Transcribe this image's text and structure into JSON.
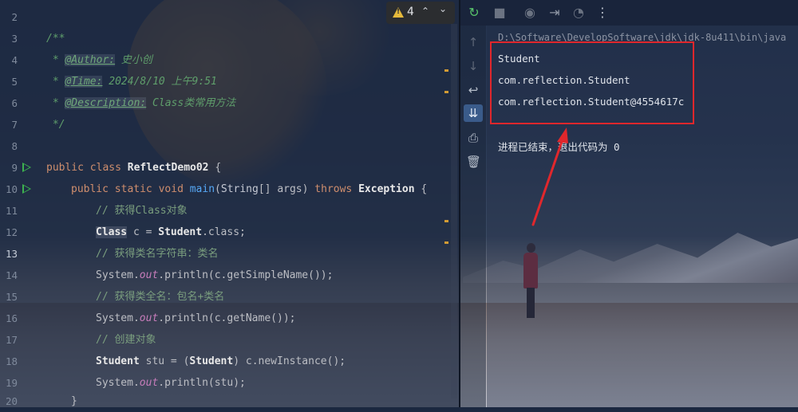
{
  "editor": {
    "warnings": {
      "count": "4",
      "icon": "warning-icon"
    },
    "lines": {
      "l2": "2",
      "l3": "3",
      "l4": "4",
      "l5": "5",
      "l6": "6",
      "l7": "7",
      "l8": "8",
      "l9": "9",
      "l10": "10",
      "l11": "11",
      "l12": "12",
      "l13": "13",
      "l14": "14",
      "l15": "15",
      "l16": "16",
      "l17": "17",
      "l18": "18",
      "l19": "19",
      "l20": "20"
    },
    "code": {
      "doc_open": "/**",
      "doc_star": " * ",
      "author_tag": "@Author:",
      "author_val": " 史小创",
      "time_tag": "@Time:",
      "time_val": " 2024/8/10 上午9:51",
      "desc_tag": "@Description:",
      "desc_val": " Class类常用方法",
      "doc_close": " */",
      "kw_public": "public",
      "kw_class": "class",
      "class_name": "ReflectDemo02",
      "brace_open": " {",
      "kw_static": "static",
      "kw_void": "void",
      "method_main": "main",
      "main_params_open": "(",
      "type_string": "String",
      "params_rest": "[] args)",
      "kw_throws": "throws",
      "exc": "Exception",
      "cmt_get_class": "// 获得Class对象",
      "type_class": "Class",
      "line12_rest": " c = ",
      "type_student": "Student",
      "dot_class": ".class;",
      "cmt_simple": "// 获得类名字符串：类名",
      "sys": "System.",
      "out": "out",
      "println_simple": ".println(c.getSimpleName());",
      "cmt_full": "// 获得类全名：包名+类名",
      "println_name": ".println(c.getName());",
      "cmt_create": "// 创建对象",
      "stu_decl": " stu = (",
      "stu_cast_close": ") c.newInstance();",
      "println_stu": ".println(stu);",
      "brace_close": "}"
    }
  },
  "console": {
    "command": "D:\\Software\\DevelopSoftware\\jdk\\jdk-8u411\\bin\\java",
    "output": [
      "Student",
      "com.reflection.Student",
      "com.reflection.Student@4554617c"
    ],
    "exit_message": "进程已结束，退出代码为 0"
  },
  "colors": {
    "annotation_red": "#e0272c",
    "run_green": "#3fb950",
    "warning_yellow": "#e5b93b"
  }
}
